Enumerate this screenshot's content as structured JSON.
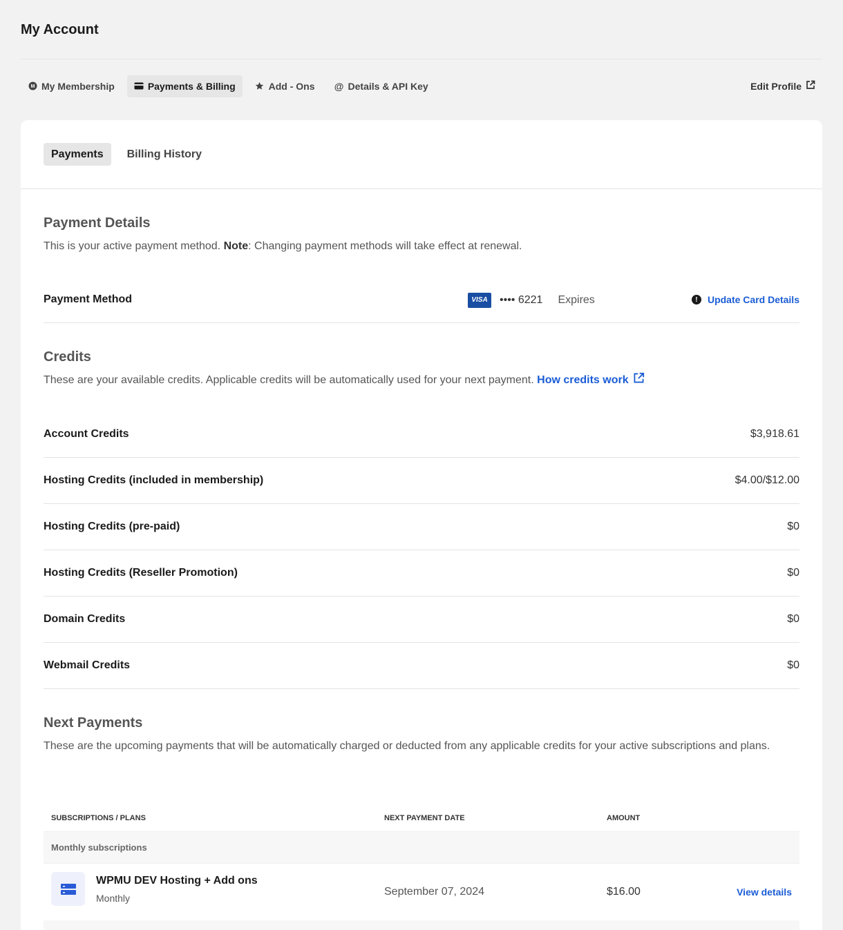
{
  "page": {
    "title": "My Account"
  },
  "nav": {
    "items": [
      {
        "label": "My Membership",
        "icon": "membership-icon"
      },
      {
        "label": "Payments & Billing",
        "icon": "card-icon"
      },
      {
        "label": "Add - Ons",
        "icon": "star-icon"
      },
      {
        "label": "Details & API Key",
        "icon": "at-icon"
      }
    ],
    "active": "Payments & Billing",
    "edit_profile": "Edit Profile"
  },
  "subtabs": [
    {
      "label": "Payments"
    },
    {
      "label": "Billing History"
    }
  ],
  "payment_details": {
    "title": "Payment Details",
    "desc_prefix": "This is your active payment method. ",
    "desc_note": "Note",
    "desc_suffix": ": Changing payment methods will take effect at renewal.",
    "method_label": "Payment Method",
    "card_brand": "VISA",
    "card_number": "•••• 6221",
    "expires": "Expires",
    "update_label": "Update Card Details"
  },
  "credits": {
    "title": "Credits",
    "desc": "These are your available credits. Applicable credits will be automatically used for your next payment. ",
    "link": "How credits work",
    "rows": [
      {
        "label": "Account Credits",
        "value": "$3,918.61"
      },
      {
        "label": "Hosting Credits (included in membership)",
        "value": "$4.00/$12.00"
      },
      {
        "label": "Hosting Credits (pre-paid)",
        "value": "$0"
      },
      {
        "label": "Hosting Credits (Reseller Promotion)",
        "value": "$0"
      },
      {
        "label": "Domain Credits",
        "value": "$0"
      },
      {
        "label": "Webmail Credits",
        "value": "$0"
      }
    ]
  },
  "next_payments": {
    "title": "Next Payments",
    "desc": "These are the upcoming payments that will be automatically charged or deducted from any applicable credits for your active subscriptions and plans.",
    "columns": [
      "Subscriptions / Plans",
      "Next Payment Date",
      "Amount"
    ],
    "group": "Monthly subscriptions",
    "items": [
      {
        "name": "WPMU DEV Hosting + Add ons",
        "period": "Monthly",
        "date": "September 07, 2024",
        "amount": "$16.00",
        "action": "View details"
      }
    ]
  },
  "colors": {
    "accent": "#1a5cd6",
    "visa": "#1a4ea3",
    "background": "#f2f2f2"
  }
}
